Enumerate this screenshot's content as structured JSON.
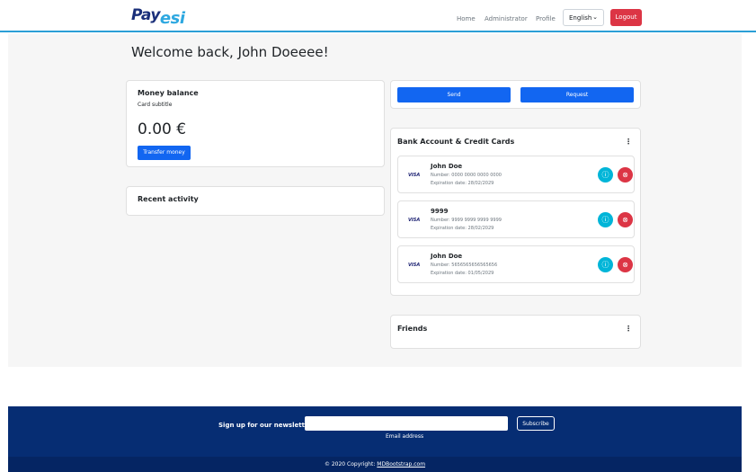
{
  "brand": {
    "part1": "Pay",
    "part2": "esi"
  },
  "nav": {
    "home": "Home",
    "administrator": "Administrator",
    "profile": "Profile",
    "language": "English",
    "logout": "Logout"
  },
  "welcome": "Welcome back, John Doeeee!",
  "balance": {
    "title": "Money balance",
    "subtitle": "Card subtitle",
    "amount": "0.00 €",
    "transfer_label": "Transfer money"
  },
  "recent_activity": {
    "title": "Recent activity"
  },
  "actions": {
    "send": "Send",
    "request": "Request"
  },
  "bank": {
    "title": "Bank Account & Credit Cards",
    "cards": [
      {
        "brand": "VISA",
        "name": "John Doe",
        "number": "Number: 0000 0000 0000 0000",
        "expiration": "Expiration date: 28/02/2029"
      },
      {
        "brand": "VISA",
        "name": "9999",
        "number": "Number: 9999 9999 9999 9999",
        "expiration": "Expiration date: 28/02/2029"
      },
      {
        "brand": "VISA",
        "name": "John Doe",
        "number": "Number: 5656565656565656",
        "expiration": "Expiration date: 01/05/2029"
      }
    ]
  },
  "friends": {
    "title": "Friends"
  },
  "footer": {
    "newsletter_label": "Sign up for our newsletter",
    "email_help": "Email address",
    "subscribe": "Subscribe",
    "copyright_text": "© 2020 Copyright:",
    "copyright_link": "MDBootstrap.com"
  },
  "colors": {
    "primary": "#1266f1",
    "danger": "#dc3545",
    "info": "#00b5d8",
    "footer": "#062d73",
    "accent_line": "#2b9fd6"
  }
}
